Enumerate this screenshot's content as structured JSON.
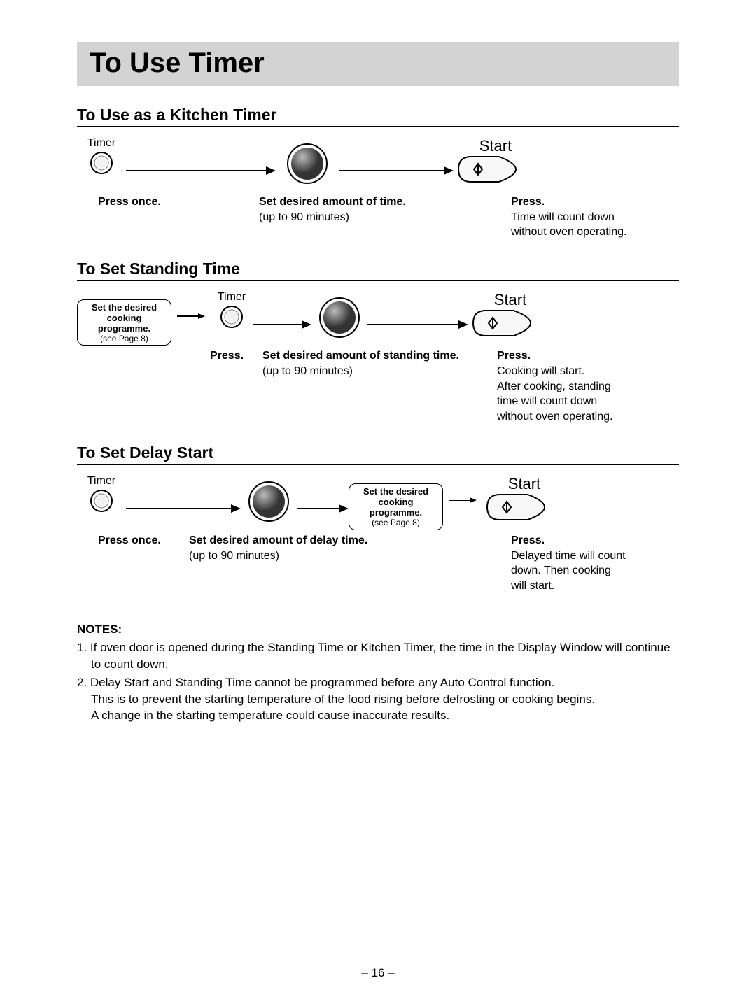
{
  "title": "To Use Timer",
  "page_number": "– 16 –",
  "labels": {
    "timer": "Timer",
    "start": "Start"
  },
  "prog_box": {
    "line1": "Set the desired",
    "line2": "cooking programme.",
    "sub": "(see Page 8)"
  },
  "sections": {
    "kitchen": {
      "heading": "To Use as a Kitchen Timer",
      "c1_bold": "Press once.",
      "c2_bold": "Set desired amount of time.",
      "c2_sub": "(up to 90 minutes)",
      "c3_bold": "Press.",
      "c3_l1": "Time will count down",
      "c3_l2": "without oven operating."
    },
    "standing": {
      "heading": "To Set Standing Time",
      "c1_bold": "Press.",
      "c2_bold": "Set desired amount of standing time.",
      "c2_sub": "(up to 90 minutes)",
      "c3_bold": "Press.",
      "c3_l1": "Cooking will start.",
      "c3_l2": "After cooking, standing",
      "c3_l3": "time will count down",
      "c3_l4": "without oven operating."
    },
    "delay": {
      "heading": "To Set Delay Start",
      "c1_bold": "Press once.",
      "c2_bold": "Set desired amount of delay time.",
      "c2_sub": "(up to 90 minutes)",
      "c3_bold": "Press.",
      "c3_l1": "Delayed time will count",
      "c3_l2": "down. Then cooking",
      "c3_l3": "will start."
    }
  },
  "notes": {
    "head": "NOTES:",
    "n1": "1. If oven door is opened during the Standing Time or Kitchen Timer, the time in the Display Window will continue to count down.",
    "n2a": "2. Delay Start  and Standing Time cannot be programmed before any Auto Control function.",
    "n2b": "This is to prevent the starting temperature of the food rising before defrosting or cooking begins.",
    "n2c": "A change in the starting temperature could cause inaccurate results."
  }
}
